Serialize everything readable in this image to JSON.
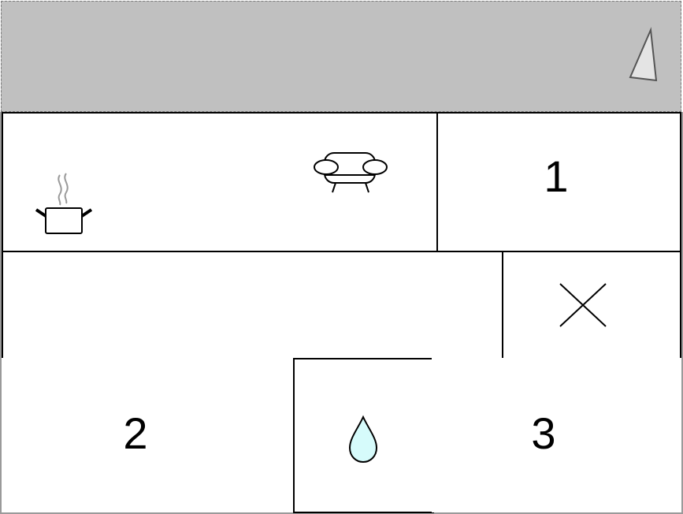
{
  "floor_plan": {
    "rooms": [
      {
        "id": "kitchen-living",
        "label": "",
        "fixtures": [
          "stove-pot-icon",
          "sofa-icon"
        ]
      },
      {
        "id": "room-1",
        "label": "1"
      },
      {
        "id": "corridor",
        "label": ""
      },
      {
        "id": "room-x",
        "label": "",
        "fixtures": [
          "cross-icon"
        ]
      },
      {
        "id": "room-2",
        "label": "2"
      },
      {
        "id": "bathroom",
        "label": "",
        "fixtures": [
          "water-drop-icon"
        ]
      },
      {
        "id": "room-3",
        "label": "3"
      }
    ],
    "north_arrow_icon": "north-arrow-icon",
    "colors": {
      "banner": "#c0c0c0",
      "frame": "#9a9a9a",
      "wall": "#000000",
      "water_drop": "#d6fbfb",
      "steam": "#9a9a9a"
    }
  }
}
